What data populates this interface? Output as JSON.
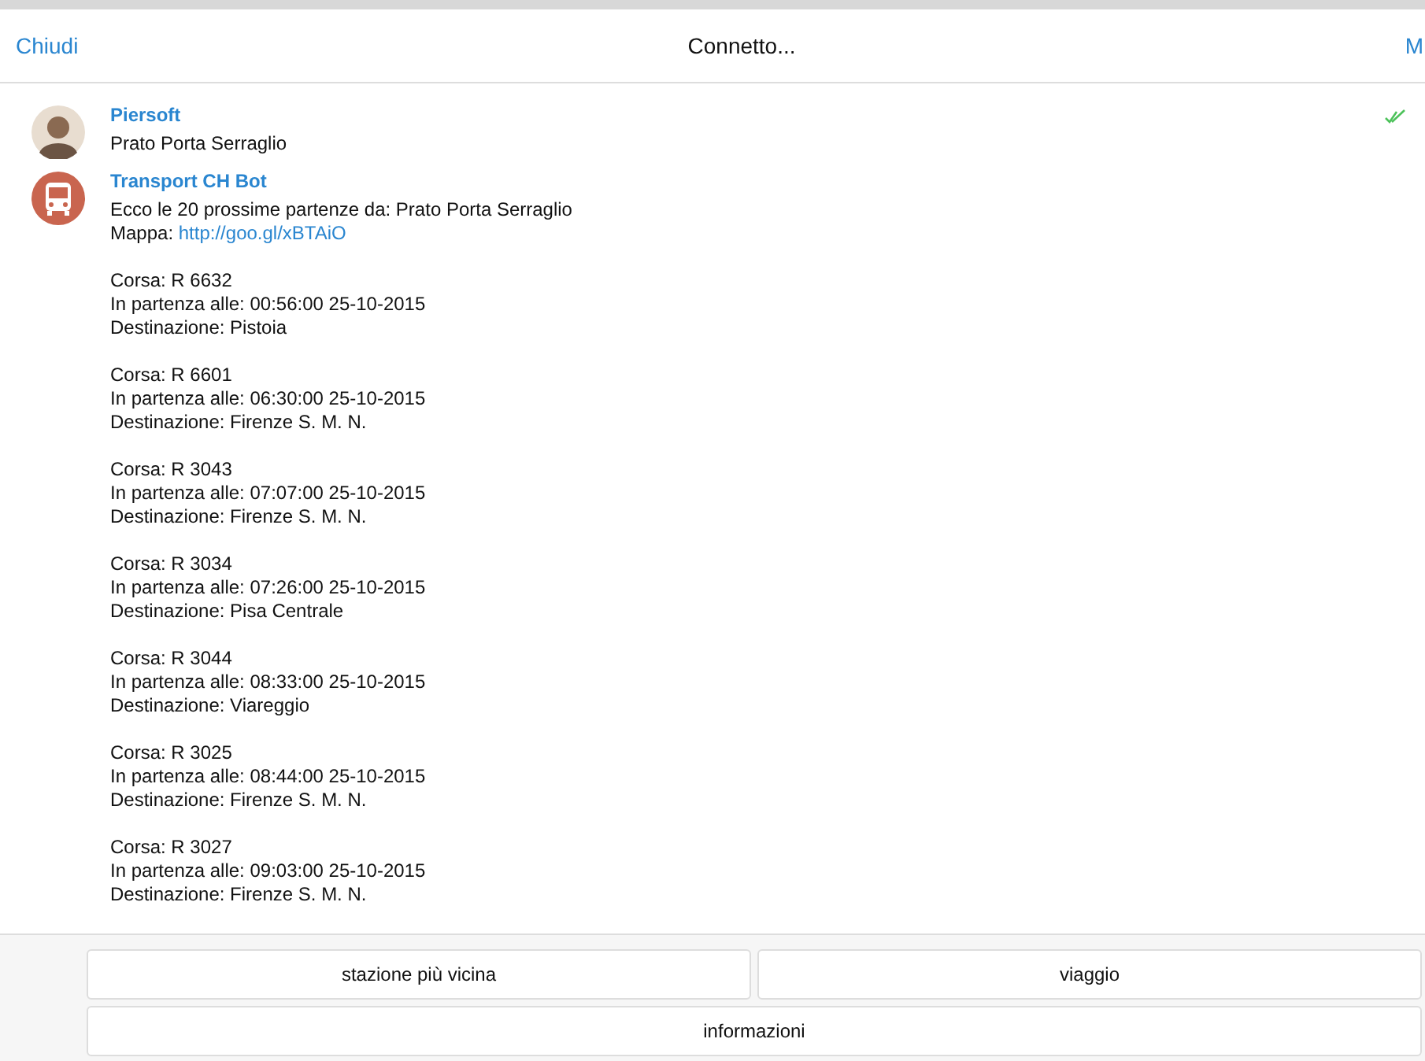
{
  "header": {
    "left": "Chiudi",
    "title": "Connetto...",
    "right": "M"
  },
  "messages": [
    {
      "kind": "user",
      "sender": "Piersoft",
      "text": "Prato Porta Serraglio",
      "read": true
    },
    {
      "kind": "bot",
      "sender": "Transport CH Bot",
      "intro": "Ecco le 20 prossime partenze da: Prato Porta Serraglio",
      "map_label": "Mappa:",
      "map_link": "http://goo.gl/xBTAiO",
      "trips": [
        {
          "run": "Corsa: R 6632",
          "departure": "In partenza alle: 00:56:00 25-10-2015",
          "destination": "Destinazione: Pistoia"
        },
        {
          "run": "Corsa: R 6601",
          "departure": "In partenza alle: 06:30:00 25-10-2015",
          "destination": "Destinazione: Firenze S. M. N."
        },
        {
          "run": "Corsa: R 3043",
          "departure": "In partenza alle: 07:07:00 25-10-2015",
          "destination": "Destinazione: Firenze S. M. N."
        },
        {
          "run": "Corsa: R 3034",
          "departure": "In partenza alle: 07:26:00 25-10-2015",
          "destination": "Destinazione: Pisa Centrale"
        },
        {
          "run": "Corsa: R 3044",
          "departure": "In partenza alle: 08:33:00 25-10-2015",
          "destination": "Destinazione: Viareggio"
        },
        {
          "run": "Corsa: R 3025",
          "departure": "In partenza alle: 08:44:00 25-10-2015",
          "destination": "Destinazione: Firenze S. M. N."
        },
        {
          "run": "Corsa: R 3027",
          "departure": "In partenza alle: 09:03:00 25-10-2015",
          "destination": "Destinazione: Firenze S. M. N."
        }
      ]
    }
  ],
  "keyboard": [
    [
      "stazione più vicina",
      "viaggio"
    ],
    [
      "informazioni"
    ]
  ]
}
